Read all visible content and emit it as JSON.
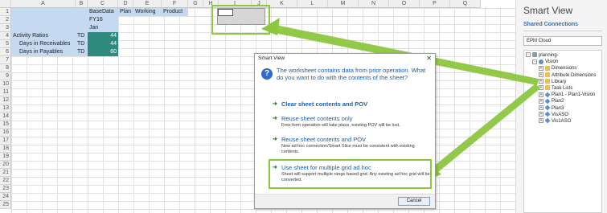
{
  "sheet": {
    "columns": [
      "A",
      "B",
      "C",
      "D",
      "E",
      "F",
      "G",
      "H",
      "I",
      "J",
      "K",
      "L",
      "M",
      "N",
      "O",
      "P",
      "Q"
    ],
    "rows": [
      "1",
      "2",
      "3",
      "4",
      "5",
      "6",
      "7",
      "8",
      "9",
      "10",
      "11",
      "12",
      "13",
      "14",
      "15",
      "16",
      "17",
      "18",
      "19",
      "20",
      "21",
      "22",
      "23",
      "24",
      "25"
    ],
    "cells": {
      "c1": "BaseData",
      "d1": "Plan",
      "e1": "Working",
      "f1": "Product",
      "c2": "FY16",
      "c3": "Jan",
      "a4": "Activity Ratios",
      "b4": "TD",
      "c4": "44",
      "a5": "Days in Receivables",
      "b5": "TD",
      "c5": "44",
      "a6": "Days in Payables",
      "b6": "TD",
      "c6": "60"
    }
  },
  "dialog": {
    "title": "Smart View",
    "close": "✕",
    "message": "The worksheet contains data from prior operation. What do you want to do with the contents of the sheet?",
    "options": [
      {
        "title": "Clear sheet contents and POV",
        "description": ""
      },
      {
        "title": "Reuse sheet contents only",
        "description": "Free-form operation will take place, existing POV will be lost."
      },
      {
        "title": "Reuse sheet contents and POV",
        "description": "New ad hoc connection/Smart Slice must be consistent with existing contents."
      },
      {
        "title": "Use sheet for multiple grid ad hoc",
        "description": "Sheet will support multiple range based grid. Any existing ad hoc grid will be converted."
      }
    ],
    "cancel_label": "Cancel"
  },
  "smart_view_panel": {
    "title": "Smart View",
    "shared_connections": "Shared Connections",
    "dropdown_value": "EPM Cloud",
    "tree": [
      {
        "label": "planning-",
        "level": 0,
        "expander": "-",
        "icon": "server-icon"
      },
      {
        "label": "Vision",
        "level": 1,
        "expander": "-",
        "icon": "application-icon"
      },
      {
        "label": "Dimensions",
        "level": 2,
        "expander": "+",
        "icon": "folder-icon"
      },
      {
        "label": "Attribute Dimensions",
        "level": 2,
        "expander": "+",
        "icon": "folder-icon"
      },
      {
        "label": "Library",
        "level": 2,
        "expander": "+",
        "icon": "folder-icon"
      },
      {
        "label": "Task Lists",
        "level": 2,
        "expander": "+",
        "icon": "folder-icon"
      },
      {
        "label": "Plan1 - Plan1-Vision",
        "level": 2,
        "expander": "+",
        "icon": "cube-icon"
      },
      {
        "label": "Plan2",
        "level": 2,
        "expander": "+",
        "icon": "cube-icon"
      },
      {
        "label": "Plan3",
        "level": 2,
        "expander": "+",
        "icon": "cube-icon"
      },
      {
        "label": "VisASO",
        "level": 2,
        "expander": "+",
        "icon": "cube-icon"
      },
      {
        "label": "Vis1ASO",
        "level": 2,
        "expander": "+",
        "icon": "cube-icon"
      }
    ]
  },
  "colors": {
    "highlight_green": "#8dc63f",
    "header_blue": "#c5d9f1",
    "data_teal": "#2f8a7e",
    "link_blue": "#1b5fa8"
  }
}
